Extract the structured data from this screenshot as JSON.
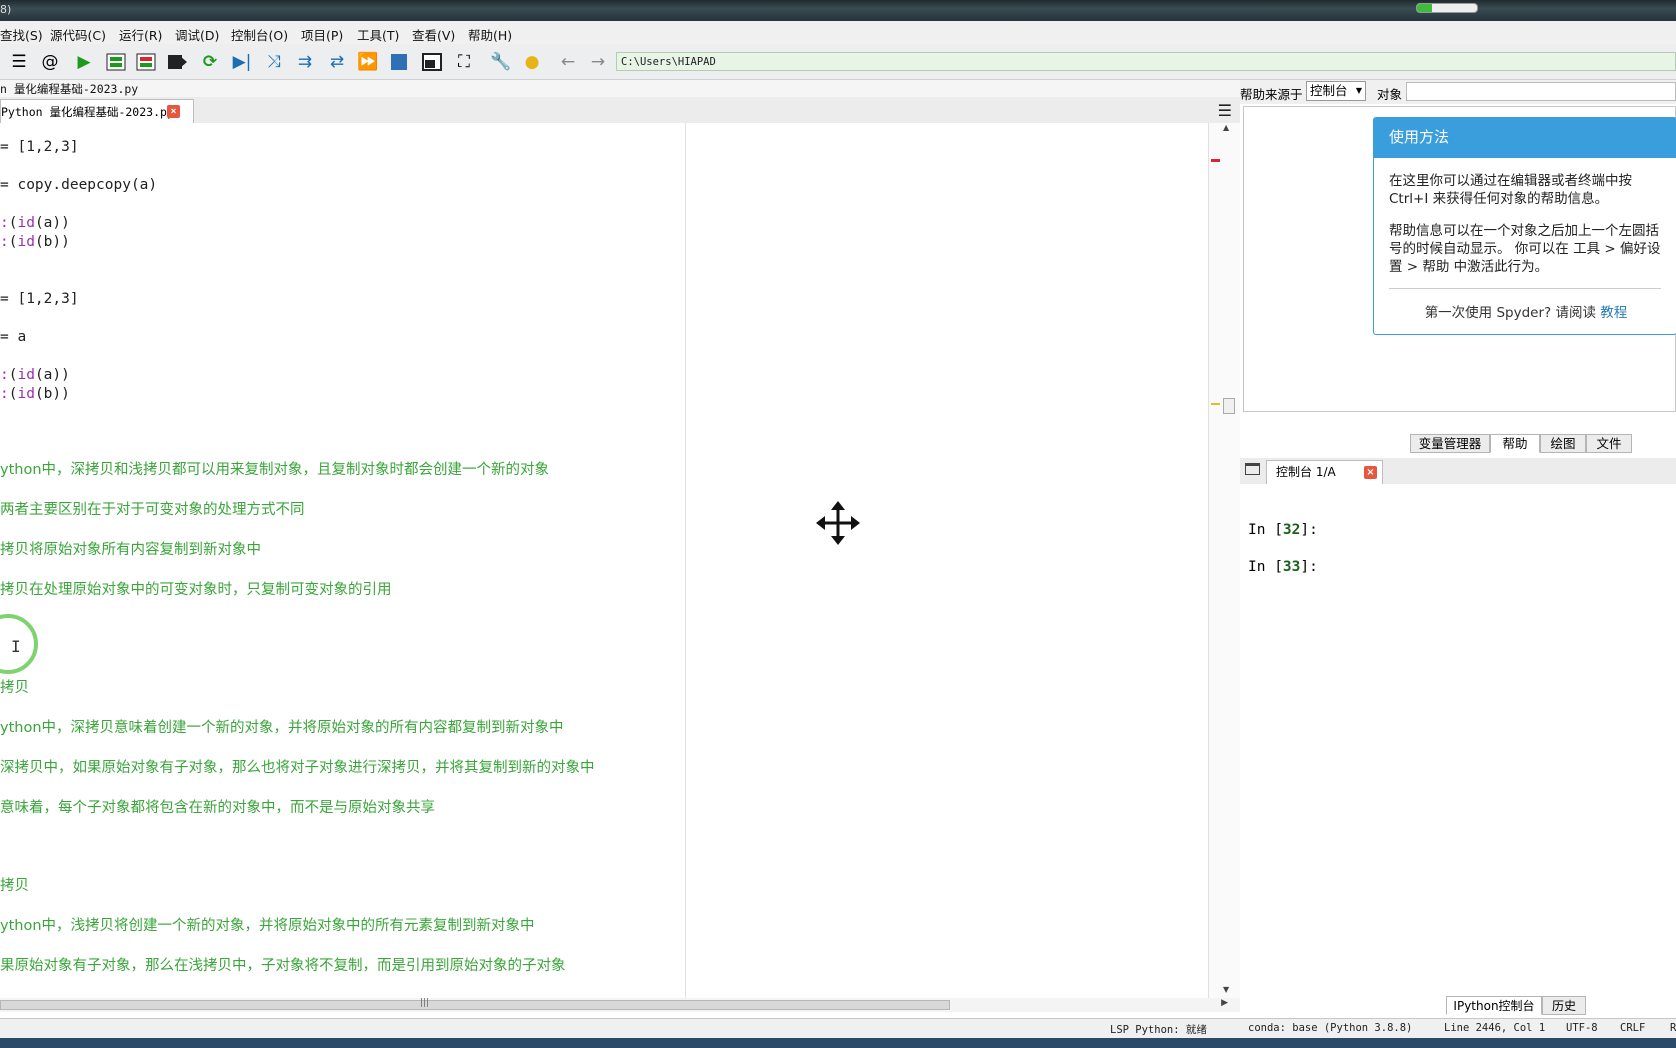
{
  "window": {
    "title_fragment": "8)"
  },
  "menu": [
    "查找(S)",
    "源代码(C)",
    "运行(R)",
    "调试(D)",
    "控制台(O)",
    "项目(P)",
    "工具(T)",
    "查看(V)",
    "帮助(H)"
  ],
  "toolbar": {
    "path": "C:\\Users\\HIAPAD",
    "icons": [
      "outline-icon",
      "at-icon",
      "run-icon",
      "run-cell-icon",
      "run-cell-advance-icon",
      "run-selection-icon",
      "rerun-icon",
      "debug-icon",
      "step-icon",
      "step-into-icon",
      "step-return-icon",
      "continue-icon",
      "stop-icon",
      "maximize-pane-icon",
      "fullscreen-icon",
      "preferences-icon",
      "python-path-icon",
      "back-arrow-icon",
      "forward-arrow-icon"
    ]
  },
  "editor": {
    "file_path": "n 量化编程基础-2023.py",
    "tab_label": "Python 量化编程基础-2023.py",
    "lines": [
      {
        "segments": [
          {
            "t": "= [1,2,3]",
            "c": "code"
          }
        ]
      },
      {
        "segments": [
          {
            "t": "= copy.deepcopy(a)",
            "c": "code"
          }
        ]
      },
      {
        "segments": [
          {
            "t": ":",
            "c": "kw"
          },
          {
            "t": "(",
            "c": "code"
          },
          {
            "t": "id",
            "c": "kw"
          },
          {
            "t": "(a))",
            "c": "code"
          }
        ]
      },
      {
        "segments": [
          {
            "t": ":",
            "c": "kw"
          },
          {
            "t": "(",
            "c": "code"
          },
          {
            "t": "id",
            "c": "kw"
          },
          {
            "t": "(b))",
            "c": "code"
          }
        ]
      },
      {
        "segments": [
          {
            "t": "= [1,2,3]",
            "c": "code"
          }
        ]
      },
      {
        "segments": [
          {
            "t": "= a",
            "c": "code"
          }
        ]
      },
      {
        "segments": [
          {
            "t": ":",
            "c": "kw"
          },
          {
            "t": "(",
            "c": "code"
          },
          {
            "t": "id",
            "c": "kw"
          },
          {
            "t": "(a))",
            "c": "code"
          }
        ]
      },
      {
        "segments": [
          {
            "t": ":",
            "c": "kw"
          },
          {
            "t": "(",
            "c": "code"
          },
          {
            "t": "id",
            "c": "kw"
          },
          {
            "t": "(b))",
            "c": "code"
          }
        ]
      },
      {
        "segments": [
          {
            "t": "ython中，深拷贝和浅拷贝都可以用来复制对象，且复制对象时都会创建一个新的对象",
            "c": "cm"
          }
        ]
      },
      {
        "segments": [
          {
            "t": "两者主要区别在于对于可变对象的处理方式不同",
            "c": "cm"
          }
        ]
      },
      {
        "segments": [
          {
            "t": "拷贝将原始对象所有内容复制到新对象中",
            "c": "cm"
          }
        ]
      },
      {
        "segments": [
          {
            "t": "拷贝在处理原始对象中的可变对象时，只复制可变对象的引用",
            "c": "cm"
          }
        ]
      },
      {
        "segments": [
          {
            "t": "拷贝",
            "c": "cm"
          }
        ]
      },
      {
        "segments": [
          {
            "t": "ython中，深拷贝意味着创建一个新的对象，并将原始对象的所有内容都复制到新对象中",
            "c": "cm"
          }
        ]
      },
      {
        "segments": [
          {
            "t": "深拷贝中，如果原始对象有子对象，那么也将对子对象进行深拷贝，并将其复制到新的对象中",
            "c": "cm"
          }
        ]
      },
      {
        "segments": [
          {
            "t": "意味着，每个子对象都将包含在新的对象中，而不是与原始对象共享",
            "c": "cm"
          }
        ]
      },
      {
        "segments": [
          {
            "t": "拷贝",
            "c": "cm"
          }
        ]
      },
      {
        "segments": [
          {
            "t": "ython中，浅拷贝将创建一个新的对象，并将原始对象中的所有元素复制到新对象中",
            "c": "cm"
          }
        ]
      },
      {
        "segments": [
          {
            "t": "果原始对象有子对象，那么在浅拷贝中，子对象将不复制，而是引用到原始对象的子对象",
            "c": "cm"
          }
        ]
      }
    ]
  },
  "help": {
    "source_label": "帮助来源于",
    "source_value": "控制台",
    "object_label": "对象",
    "card_title": "使用方法",
    "card_p1": "在这里你可以通过在编辑器或者终端中按 Ctrl+I 来获得任何对象的帮助信息。",
    "card_p2": "帮助信息可以在一个对象之后加上一个左圆括号的时候自动显示。 你可以在 工具 > 偏好设置 > 帮助 中激活此行为。",
    "card_footer": "第一次使用 Spyder? 请阅读",
    "card_link": "教程",
    "tabs": [
      "变量管理器",
      "帮助",
      "绘图",
      "文件"
    ]
  },
  "console": {
    "tab_label": "控制台 1/A",
    "prompts": [
      {
        "prefix": "In [",
        "num": "32",
        "suffix": "]:"
      },
      {
        "prefix": "In [",
        "num": "33",
        "suffix": "]:"
      }
    ],
    "bottom_tabs": [
      "IPython控制台",
      "历史"
    ]
  },
  "status": {
    "lsp": "LSP Python: 就绪",
    "conda": "conda: base (Python 3.8.8)",
    "position": "Line 2446, Col 1",
    "encoding": "UTF-8",
    "eol": "CRLF",
    "rw": "R"
  },
  "colors": {
    "comment": "#3aa53a",
    "keyword": "#9b2fae",
    "help_accent": "#3a9ddc",
    "current_line": "#f5ebf6"
  }
}
